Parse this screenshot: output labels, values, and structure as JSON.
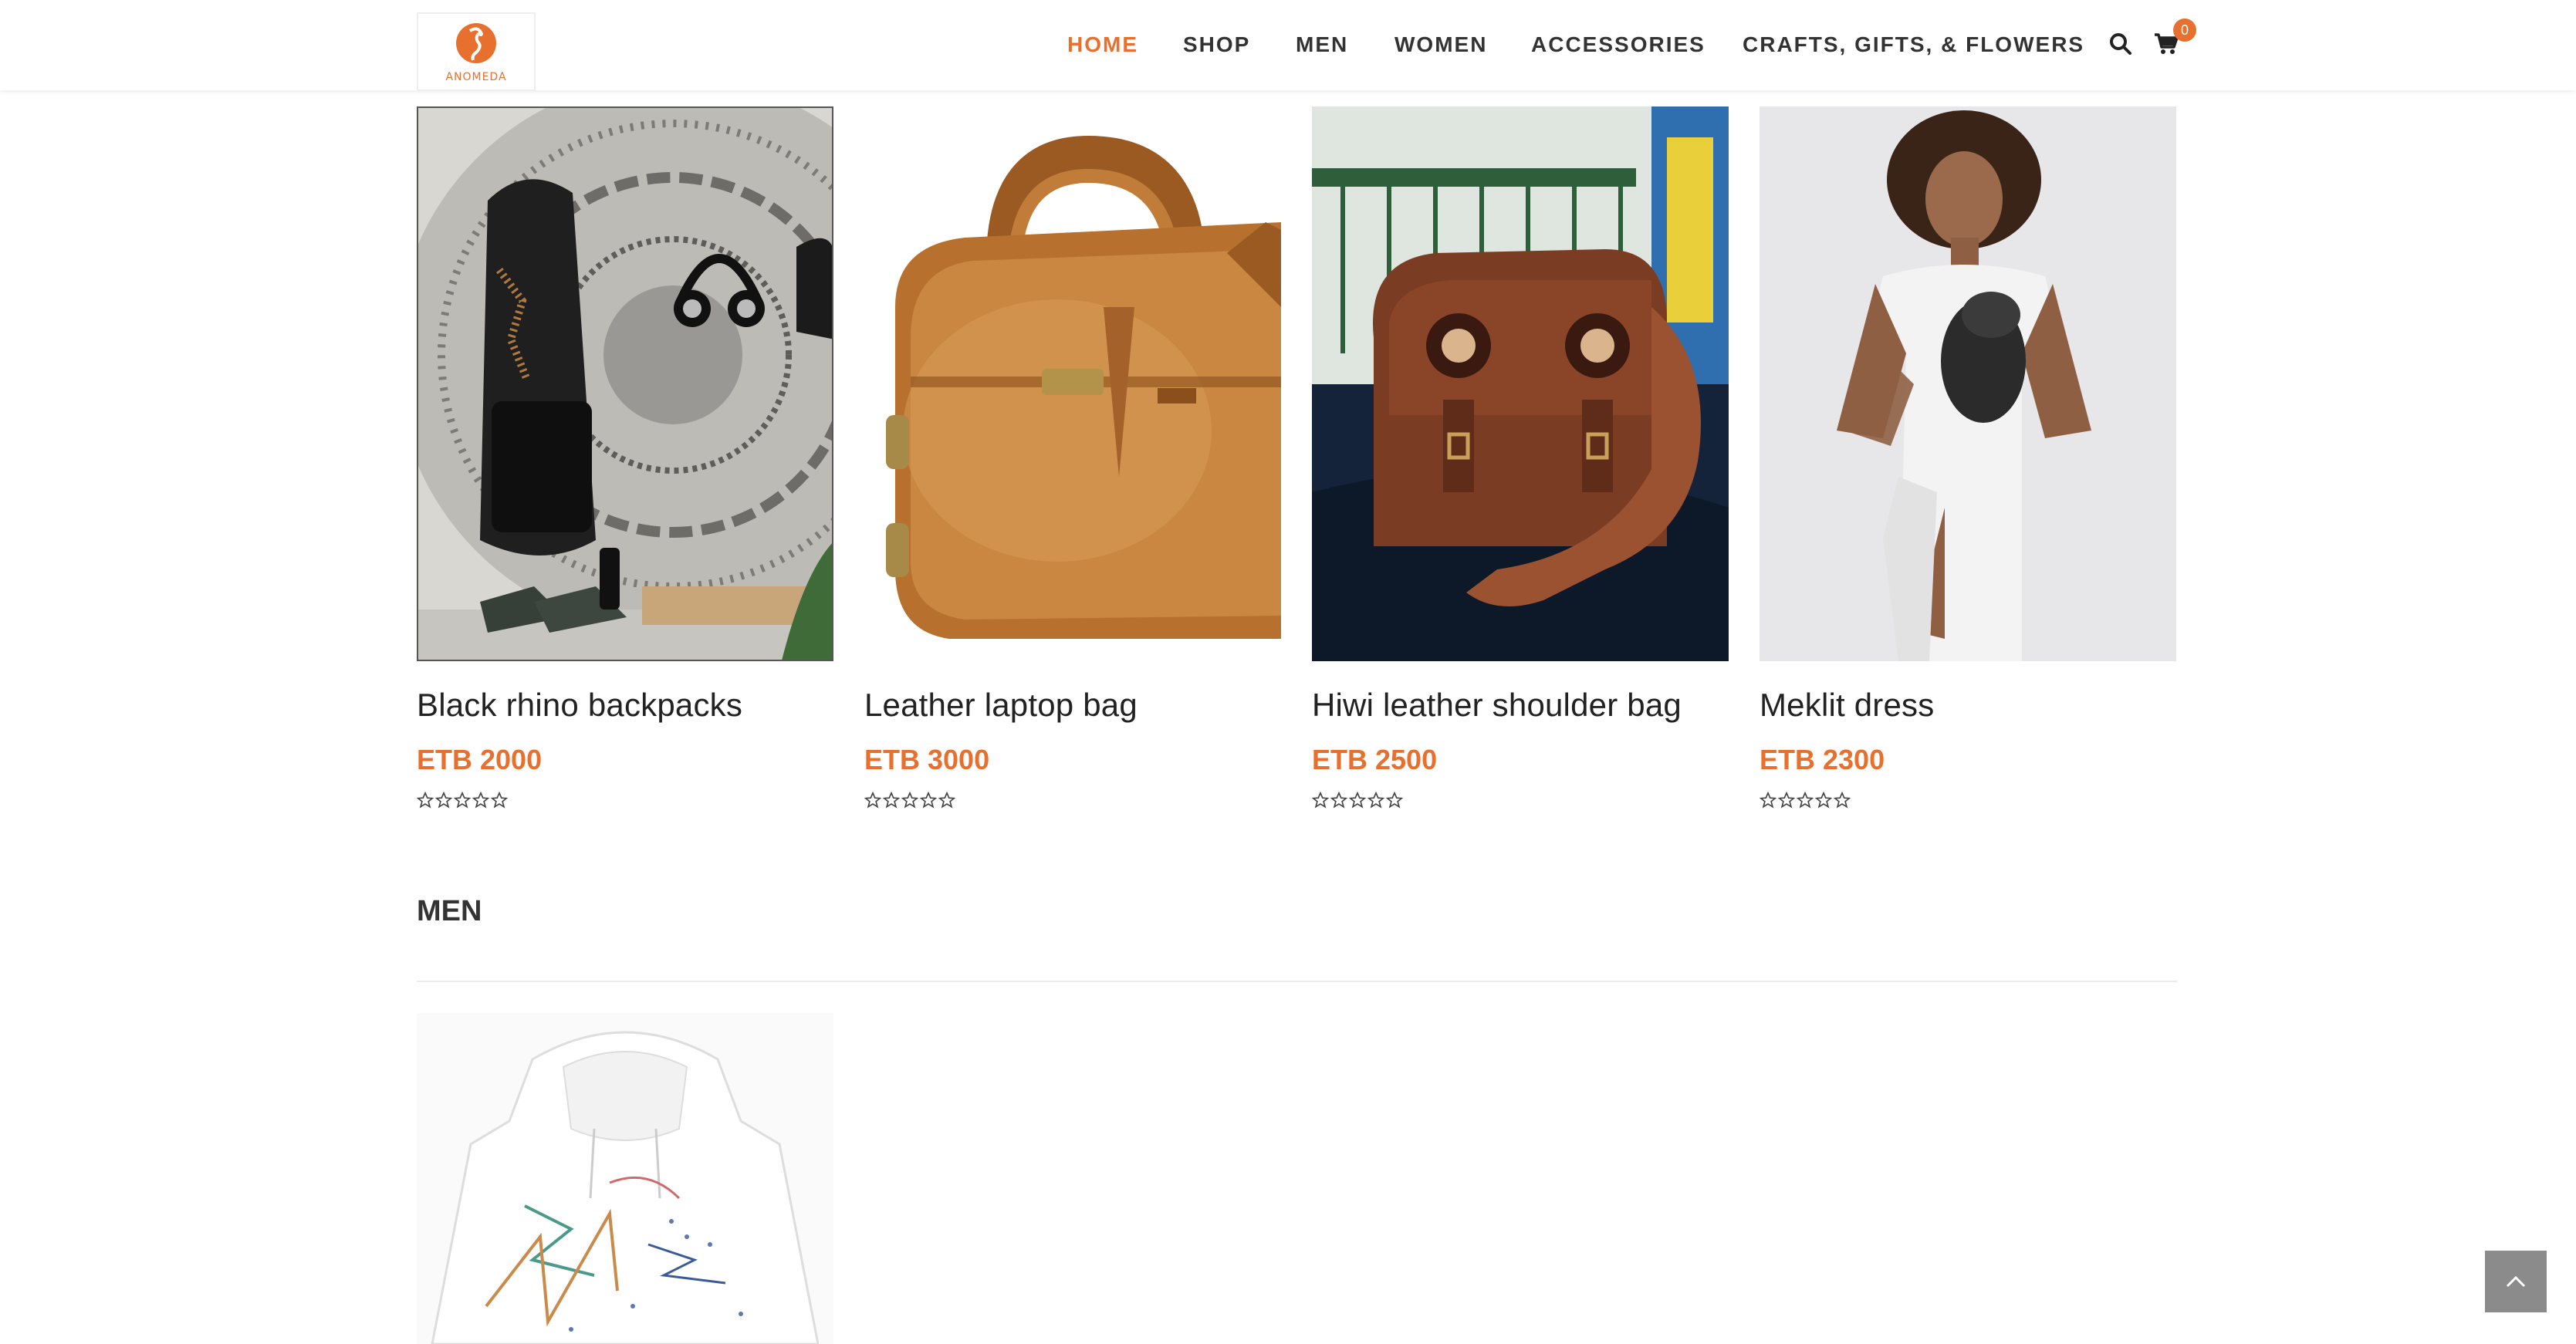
{
  "brand": {
    "logo_text": "ANOMEDA"
  },
  "nav": {
    "items": [
      {
        "label": "HOME",
        "active": true
      },
      {
        "label": "SHOP",
        "active": false
      },
      {
        "label": "MEN",
        "active": false
      },
      {
        "label": "WOMEN",
        "active": false
      },
      {
        "label": "ACCESSORIES",
        "active": false
      },
      {
        "label": "CRAFTS, GIFTS, & FLOWERS",
        "active": false
      }
    ],
    "cart_count": "0",
    "icons": [
      "search-icon",
      "cart-icon"
    ]
  },
  "products": [
    {
      "title": "Black rhino backpacks",
      "price": "ETB 2000",
      "rating": 0,
      "rating_max": 5
    },
    {
      "title": "Leather laptop bag",
      "price": "ETB 3000",
      "rating": 0,
      "rating_max": 5
    },
    {
      "title": "Hiwi leather shoulder bag",
      "price": "ETB 2500",
      "rating": 0,
      "rating_max": 5
    },
    {
      "title": "Meklit dress",
      "price": "ETB 2300",
      "rating": 0,
      "rating_max": 5
    }
  ],
  "men_section": {
    "title": "MEN"
  },
  "colors": {
    "accent": "#e8702e",
    "text": "#222222",
    "nav_text": "#333333",
    "back_to_top": "#8b8b8b"
  }
}
